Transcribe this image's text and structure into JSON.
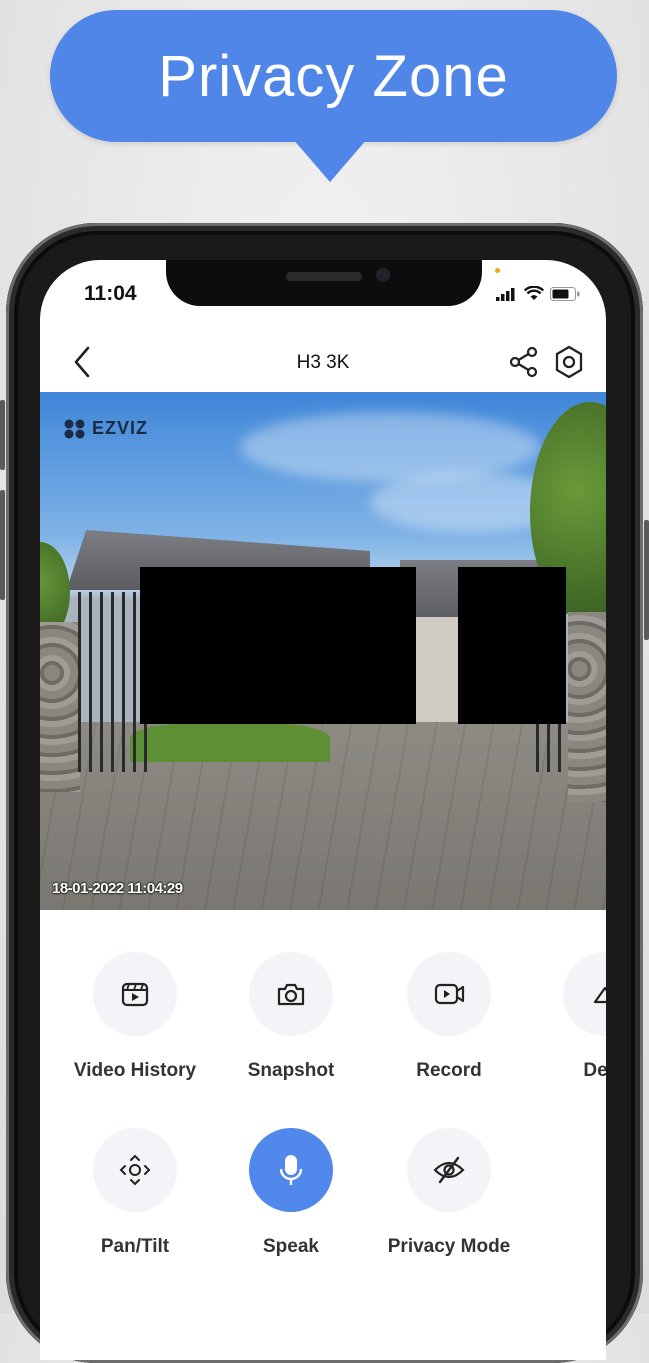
{
  "banner": {
    "title": "Privacy Zone"
  },
  "status_bar": {
    "time": "11:04"
  },
  "nav": {
    "title": "H3 3K"
  },
  "video": {
    "brand": "EZVIZ",
    "timestamp": "18-01-2022 11:04:29"
  },
  "controls": [
    {
      "label": "Video History",
      "icon": "video-history-icon"
    },
    {
      "label": "Snapshot",
      "icon": "camera-icon"
    },
    {
      "label": "Record",
      "icon": "record-icon"
    },
    {
      "label": "Defir",
      "icon": "definition-icon"
    },
    {
      "label": "Pan/Tilt",
      "icon": "pan-tilt-icon"
    },
    {
      "label": "Speak",
      "icon": "microphone-icon",
      "active": true
    },
    {
      "label": "Privacy Mode",
      "icon": "privacy-mode-icon"
    }
  ],
  "colors": {
    "accent": "#4f86e8",
    "active_button": "#5088ec"
  }
}
